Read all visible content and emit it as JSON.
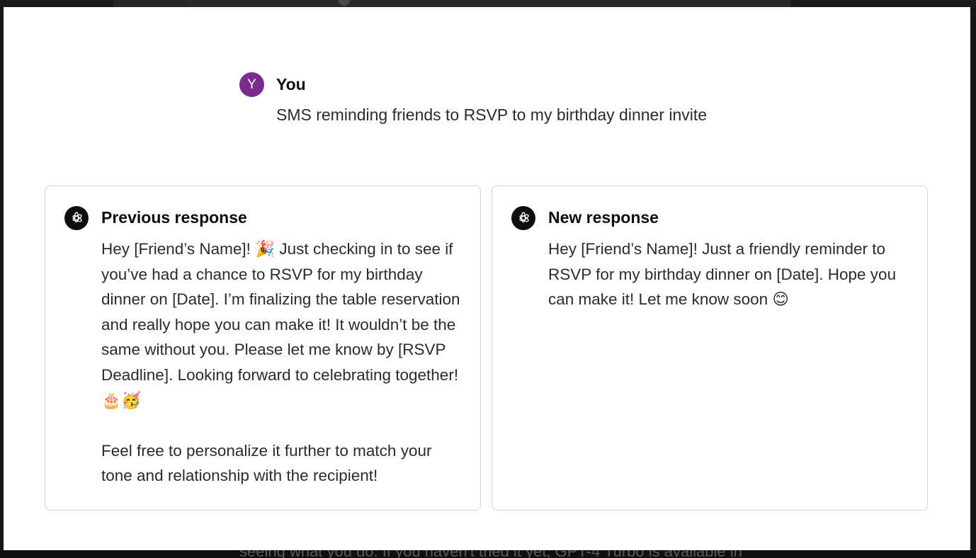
{
  "user": {
    "avatar_letter": "Y",
    "name": "You",
    "message": "SMS reminding friends to RSVP to my birthday dinner invite"
  },
  "responses": [
    {
      "title": "Previous response",
      "icon": "openai-logo-icon",
      "paragraphs": [
        "Hey [Friend’s Name]! 🎉 Just checking in to see if you’ve had a chance to RSVP for my birthday dinner on [Date]. I’m finalizing the table reservation and really hope you can make it! It wouldn’t be the same without you. Please let me know by [RSVP Deadline]. Looking forward to celebrating together! 🎂🥳",
        "Feel free to personalize it further to match your tone and relationship with the recipient!"
      ]
    },
    {
      "title": "New response",
      "icon": "openai-logo-icon",
      "paragraphs": [
        "Hey [Friend’s Name]! Just a friendly reminder to RSVP for my birthday dinner on [Date]. Hope you can make it! Let me know soon 😊"
      ]
    }
  ],
  "background_peek_text": "seeing what you do. If you haven't tried it yet, GPT-4 Turbo is available in",
  "colors": {
    "avatar_bg": "#7a2c8d",
    "bot_icon_bg": "#0d0d0d",
    "card_border": "#d3d3d3",
    "modal_bg": "#ffffff",
    "backdrop": "#161616"
  }
}
